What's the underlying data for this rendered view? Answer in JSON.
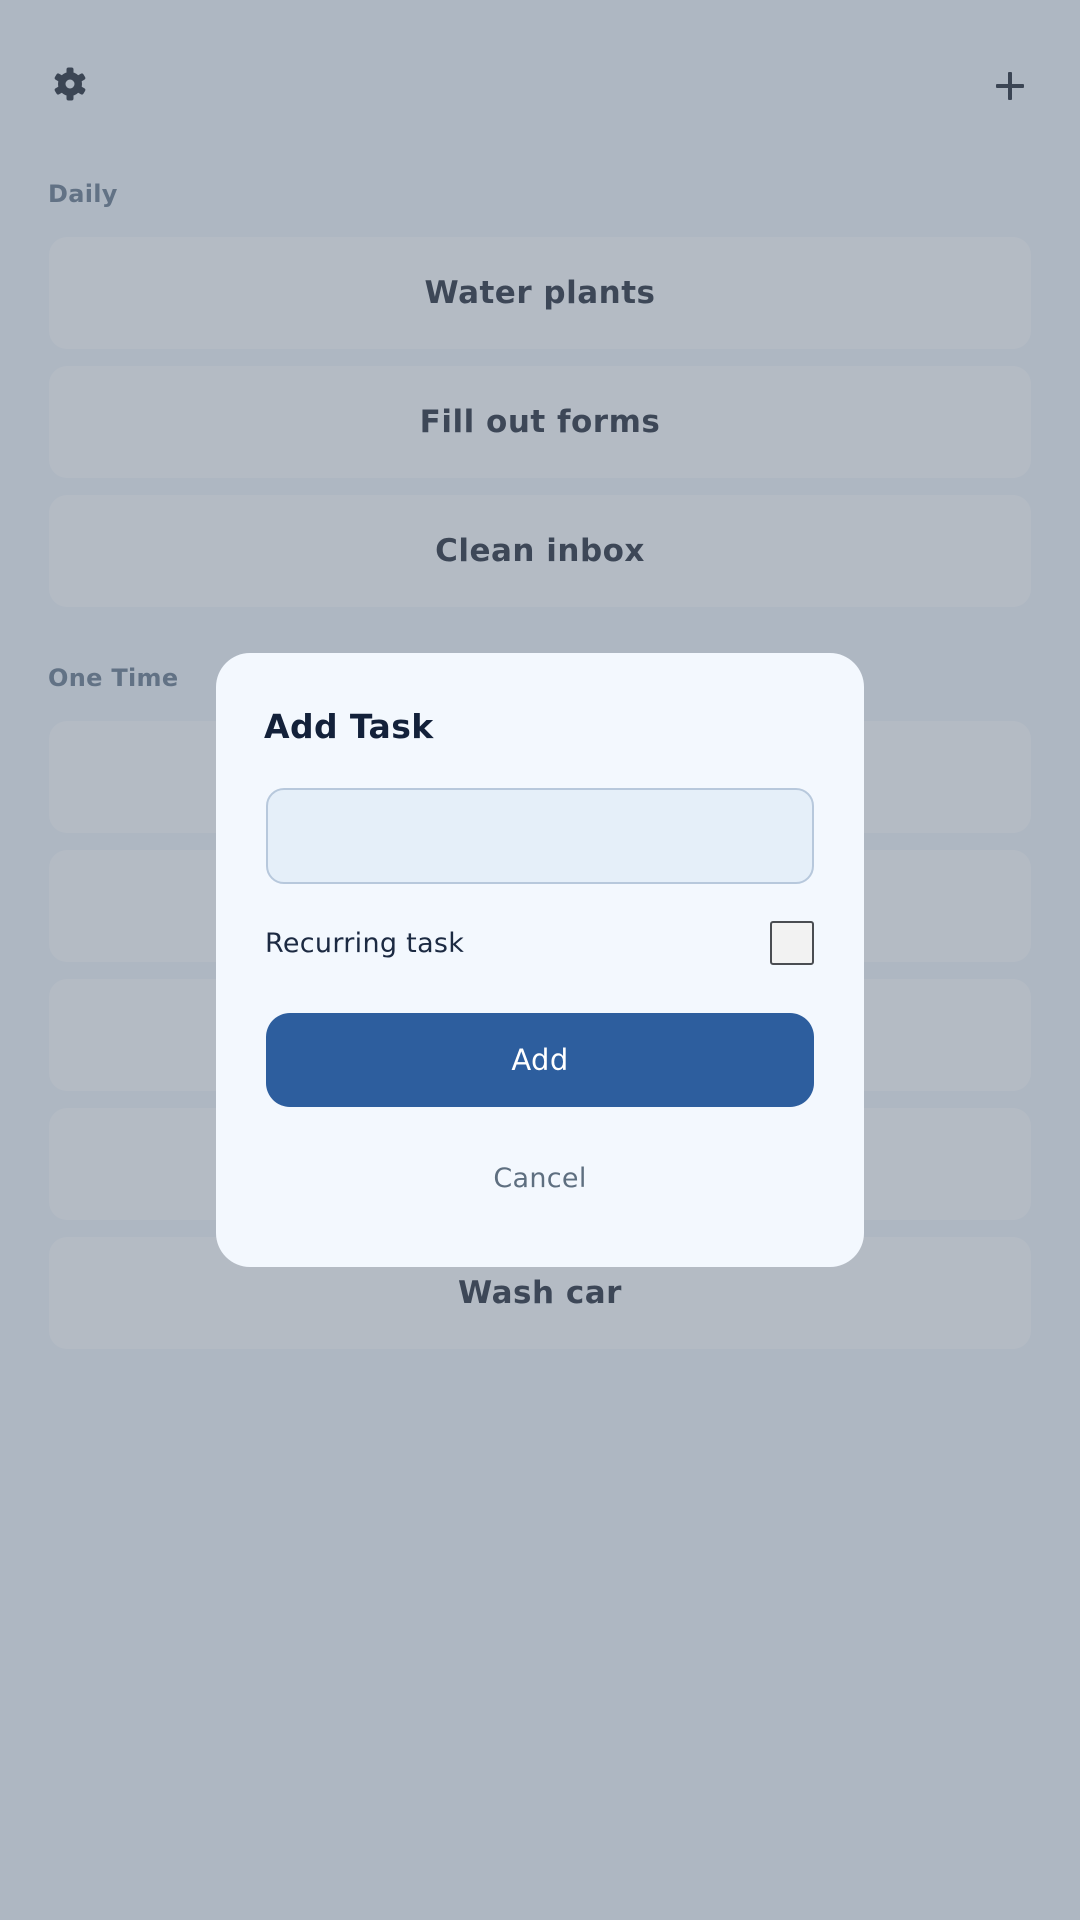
{
  "topbar": {
    "settings_icon": "gear-icon",
    "add_icon": "plus-icon"
  },
  "sections": [
    {
      "label": "Daily",
      "tasks": [
        "Water plants",
        "Fill out forms",
        "Clean inbox"
      ]
    },
    {
      "label": "One Time",
      "tasks": [
        "",
        "",
        "",
        "",
        "Wash car"
      ]
    }
  ],
  "dialog": {
    "title": "Add Task",
    "input_value": "",
    "input_placeholder": "",
    "recurring_label": "Recurring task",
    "recurring_checked": false,
    "add_label": "Add",
    "cancel_label": "Cancel"
  },
  "colors": {
    "accent": "#2d5e9e",
    "text": "#111c33",
    "section_label": "#5c7189"
  }
}
